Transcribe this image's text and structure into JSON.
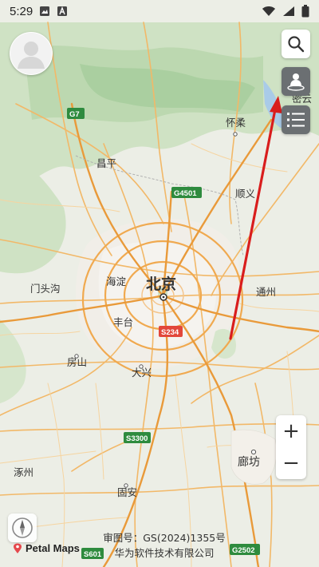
{
  "status_bar": {
    "time": "5:29"
  },
  "map": {
    "labels": {
      "beijing": "北京",
      "haidian": "海淀",
      "fengtai": "丰台",
      "daxing": "大兴",
      "fangshan": "房山",
      "mentougou": "门头沟",
      "changping": "昌平",
      "huairou": "怀柔",
      "shunyi": "顺义",
      "tongzhou": "通州",
      "langfang": "廊坊",
      "zhuozhou": "涿州",
      "guan": "固安",
      "miyun": "密云"
    },
    "roads": {
      "g7": "G7",
      "g4501": "G4501",
      "s234": "S234",
      "s3300": "S3300",
      "s601": "S601",
      "g2502": "G2502"
    },
    "annotation_color": "#d91d1d"
  },
  "controls": {
    "search_icon": "search-icon",
    "layers_icon": "person-icon",
    "menu_icon": "list-icon",
    "zoom_in": "+",
    "zoom_out": "−"
  },
  "footer": {
    "logo": "Petal Maps",
    "approval_line1": "审图号：GS(2024)1355号",
    "approval_line2": "华为软件技术有限公司"
  }
}
